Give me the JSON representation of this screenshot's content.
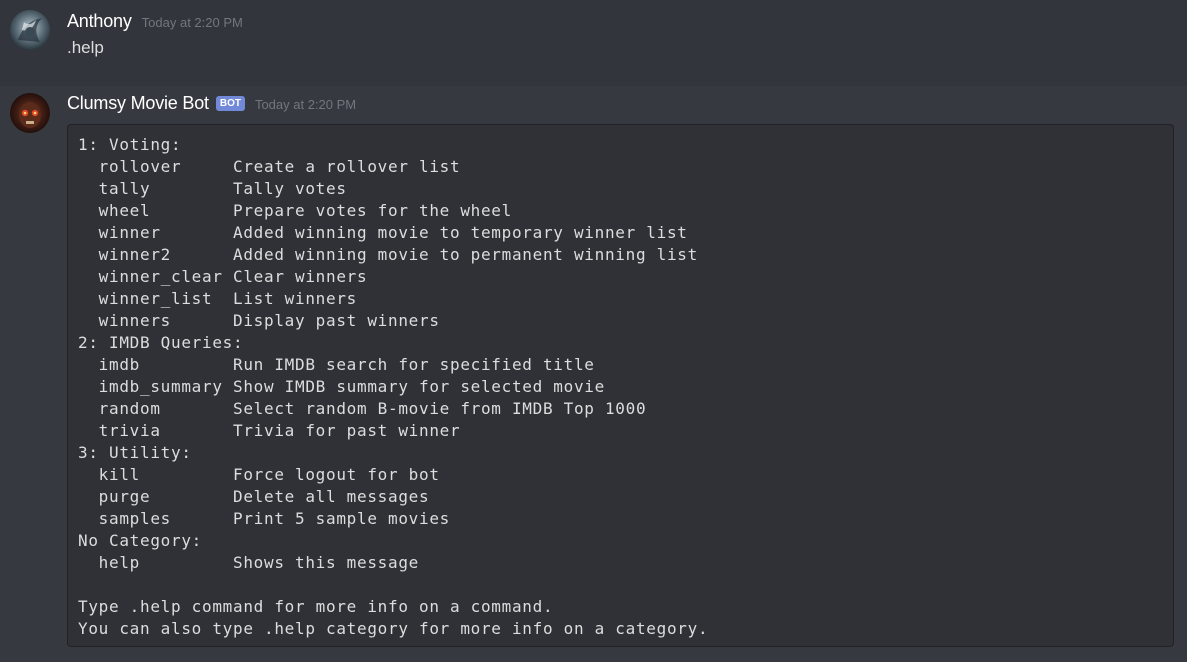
{
  "messages": [
    {
      "author": "Anthony",
      "timestamp": "Today at 2:20 PM",
      "content": ".help",
      "avatar_icon": "user-avatar-icon"
    },
    {
      "author": "Clumsy Movie Bot",
      "bot_tag": "BOT",
      "timestamp": "Today at 2:20 PM",
      "avatar_icon": "bot-avatar-icon",
      "code_block": "1: Voting:\n  rollover     Create a rollover list\n  tally        Tally votes\n  wheel        Prepare votes for the wheel\n  winner       Added winning movie to temporary winner list\n  winner2      Added winning movie to permanent winning list\n  winner_clear Clear winners\n  winner_list  List winners\n  winners      Display past winners\n2: IMDB Queries:\n  imdb         Run IMDB search for specified title\n  imdb_summary Show IMDB summary for selected movie\n  random       Select random B-movie from IMDB Top 1000\n  trivia       Trivia for past winner\n3: Utility:\n  kill         Force logout for bot\n  purge        Delete all messages\n  samples      Print 5 sample movies\nNo Category:\n  help         Shows this message\n\nType .help command for more info on a command.\nYou can also type .help category for more info on a category."
    }
  ],
  "colors": {
    "background": "#36393f",
    "highlight_row": "#32353b",
    "codeblock_bg": "#2f3136",
    "bot_tag": "#7289da",
    "timestamp": "#72767d",
    "username": "#ffffff",
    "text": "#dcddde"
  }
}
